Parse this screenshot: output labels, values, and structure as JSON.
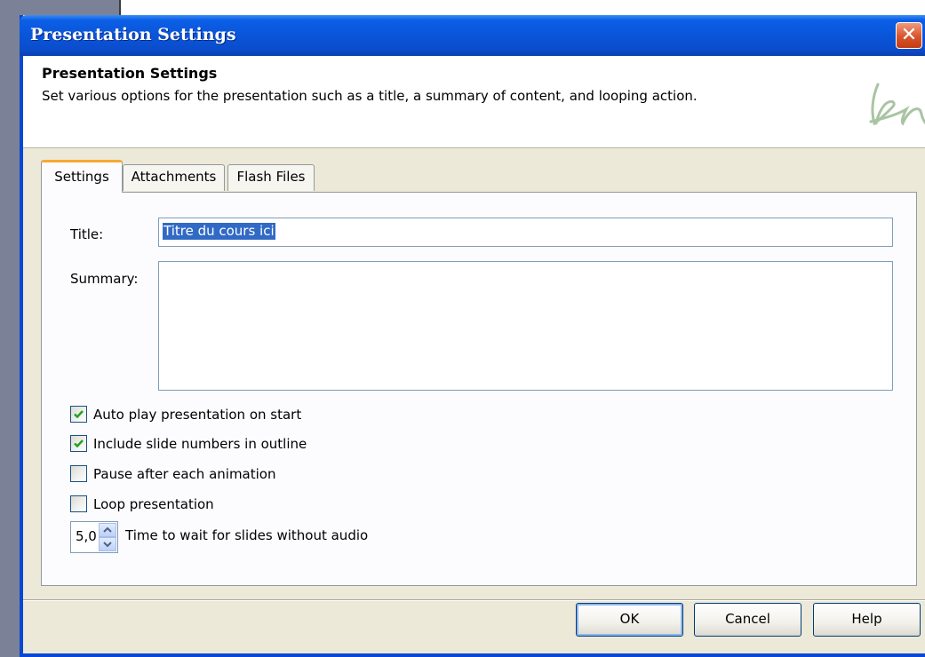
{
  "window": {
    "title": "Presentation Settings",
    "close_glyph": "✕"
  },
  "header": {
    "title": "Presentation Settings",
    "description": "Set various options for the presentation such as a title, a summary of content, and looping action."
  },
  "tabs": [
    {
      "label": "Settings",
      "active": true
    },
    {
      "label": "Attachments",
      "active": false
    },
    {
      "label": "Flash Files",
      "active": false
    }
  ],
  "settings": {
    "title_label": "Title:",
    "title_value": "Titre du cours ici",
    "summary_label": "Summary:",
    "summary_value": "",
    "options": [
      {
        "label": "Auto play presentation on start",
        "checked": true
      },
      {
        "label": "Include slide numbers in outline",
        "checked": true
      },
      {
        "label": "Pause after each animation",
        "checked": false
      },
      {
        "label": "Loop presentation",
        "checked": false
      }
    ],
    "wait_value": "5,0",
    "wait_label": "Time to wait for slides without audio"
  },
  "buttons": {
    "ok": "OK",
    "cancel": "Cancel",
    "help": "Help"
  },
  "colors": {
    "titlebar": "#0a55d9",
    "selection": "#316ac5",
    "check": "#21a121",
    "active_tab_accent": "#f8a934"
  },
  "icons": {
    "logo": "bn-logo-icon",
    "check": "checkmark-icon",
    "spin_up": "spin-up-icon",
    "spin_down": "spin-down-icon"
  }
}
